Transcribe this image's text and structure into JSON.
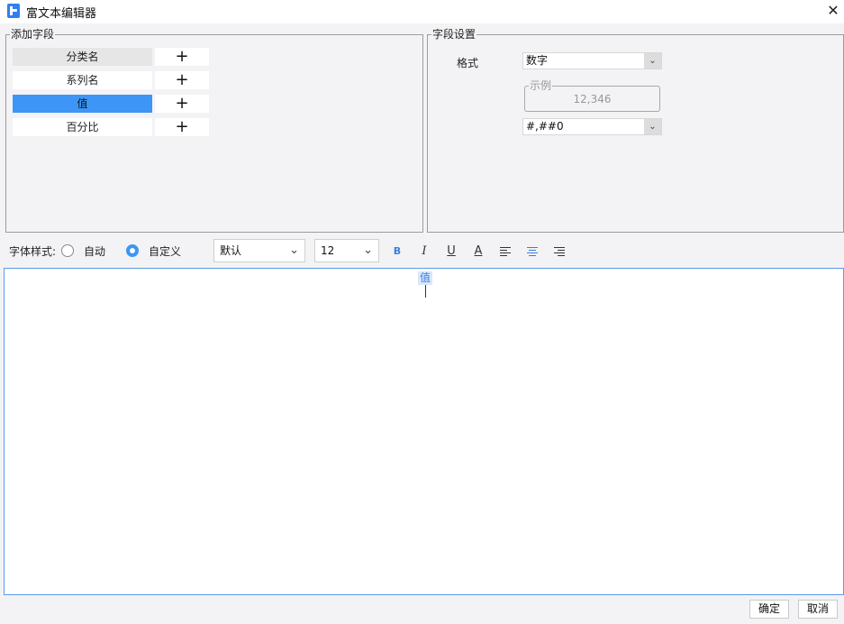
{
  "window": {
    "title": "富文本编辑器",
    "close_glyph": "✕"
  },
  "add_fields": {
    "legend": "添加字段",
    "items": [
      {
        "label": "分类名",
        "state": "hover"
      },
      {
        "label": "系列名",
        "state": "normal"
      },
      {
        "label": "值",
        "state": "selected"
      },
      {
        "label": "百分比",
        "state": "normal"
      }
    ],
    "add_glyph": "+"
  },
  "field_settings": {
    "legend": "字段设置",
    "format_label": "格式",
    "format_value": "数字",
    "sample_legend": "示例",
    "sample_value": "12,346",
    "pattern_value": "#,##0"
  },
  "toolbar": {
    "font_style_label": "字体样式:",
    "radio_auto": "自动",
    "radio_custom": "自定义",
    "selected_radio": "自定义",
    "font_family": "默认",
    "font_size": "12",
    "bold_glyph": "B",
    "italic_glyph": "I",
    "underline_glyph": "U",
    "color_glyph": "A"
  },
  "editor": {
    "token": "值"
  },
  "footer": {
    "ok_label": "确定",
    "cancel_label": "取消"
  },
  "colors": {
    "accent": "#3d96f5",
    "selection": "#3d96f5",
    "editor_border": "#5a9bea"
  }
}
